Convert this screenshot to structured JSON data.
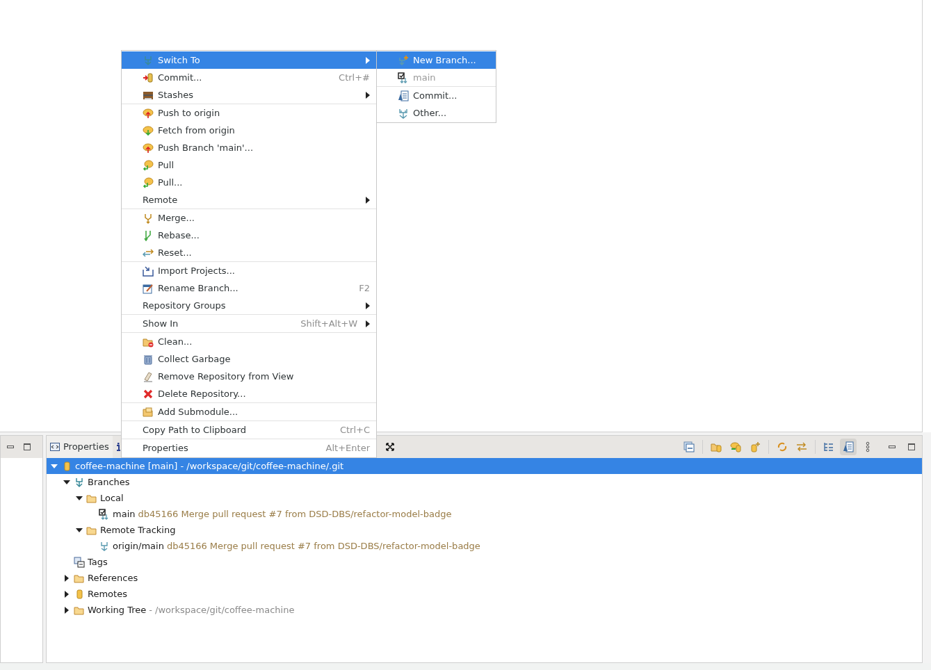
{
  "context_menu": {
    "groups": [
      [
        {
          "label": "Switch To",
          "submenu": true,
          "selected": true
        },
        {
          "label": "Commit...",
          "shortcut": "Ctrl+#",
          "submenu": false,
          "selected": false
        },
        {
          "label": "Stashes",
          "submenu": true,
          "selected": false
        }
      ],
      [
        {
          "label": "Push to origin",
          "submenu": false,
          "selected": false
        },
        {
          "label": "Fetch from origin",
          "submenu": false,
          "selected": false
        },
        {
          "label": "Push Branch 'main'...",
          "submenu": false,
          "selected": false
        },
        {
          "label": "Pull",
          "submenu": false,
          "selected": false
        },
        {
          "label": "Pull...",
          "submenu": false,
          "selected": false
        },
        {
          "label": "Remote",
          "submenu": true,
          "selected": false
        }
      ],
      [
        {
          "label": "Merge...",
          "submenu": false,
          "selected": false
        },
        {
          "label": "Rebase...",
          "submenu": false,
          "selected": false
        },
        {
          "label": "Reset...",
          "submenu": false,
          "selected": false
        }
      ],
      [
        {
          "label": "Import Projects...",
          "submenu": false,
          "selected": false
        },
        {
          "label": "Rename Branch...",
          "shortcut": "F2",
          "submenu": false,
          "selected": false
        },
        {
          "label": "Repository Groups",
          "submenu": true,
          "selected": false
        }
      ],
      [
        {
          "label": "Show In",
          "shortcut": "Shift+Alt+W",
          "submenu": true,
          "selected": false
        }
      ],
      [
        {
          "label": "Clean...",
          "submenu": false,
          "selected": false
        },
        {
          "label": "Collect Garbage",
          "submenu": false,
          "selected": false
        },
        {
          "label": "Remove Repository from View",
          "submenu": false,
          "selected": false
        },
        {
          "label": "Delete Repository...",
          "submenu": false,
          "selected": false
        }
      ],
      [
        {
          "label": "Add Submodule...",
          "submenu": false,
          "selected": false
        }
      ],
      [
        {
          "label": "Copy Path to Clipboard",
          "shortcut": "Ctrl+C",
          "submenu": false,
          "selected": false
        }
      ],
      [
        {
          "label": "Properties",
          "shortcut": "Alt+Enter",
          "submenu": false,
          "selected": false
        }
      ]
    ]
  },
  "submenu": {
    "groups": [
      [
        {
          "label": "New Branch...",
          "selected": true,
          "disabled": false
        },
        {
          "label": "main",
          "selected": false,
          "disabled": true
        }
      ],
      [
        {
          "label": "Commit...",
          "selected": false,
          "disabled": false
        },
        {
          "label": "Other...",
          "selected": false,
          "disabled": false
        }
      ]
    ]
  },
  "bottom_panel": {
    "tab": {
      "label": "Properties"
    },
    "toolbar": [
      {
        "pressed": false
      },
      {
        "pressed": false
      },
      {
        "pressed": false
      },
      {
        "pressed": false
      },
      {
        "pressed": false
      },
      {
        "pressed": false
      },
      {
        "pressed": false
      },
      {
        "pressed": true
      },
      {
        "pressed": false
      }
    ],
    "tree": [
      {
        "label": "coffee-machine [main] - /workspace/git/coffee-machine/.git",
        "expanded": true,
        "selected": true,
        "children": [
          {
            "label": "Branches",
            "expanded": true,
            "selected": false,
            "children": [
              {
                "label": "Local",
                "expanded": true,
                "selected": false,
                "children": [
                  {
                    "label": "main",
                    "detail": "db45166 Merge pull request #7 from DSD-DBS/refactor-model-badge",
                    "selected": false
                  }
                ]
              },
              {
                "label": "Remote Tracking",
                "expanded": true,
                "selected": false,
                "children": [
                  {
                    "label": "origin/main",
                    "detail": "db45166 Merge pull request #7 from DSD-DBS/refactor-model-badge",
                    "selected": false
                  }
                ]
              }
            ]
          },
          {
            "label": "Tags",
            "selected": false
          },
          {
            "label": "References",
            "expanded": false,
            "selected": false
          },
          {
            "label": "Remotes",
            "expanded": false,
            "selected": false
          },
          {
            "label": "Working Tree",
            "path": "- /workspace/git/coffee-machine",
            "expanded": false,
            "selected": false
          }
        ]
      }
    ]
  }
}
